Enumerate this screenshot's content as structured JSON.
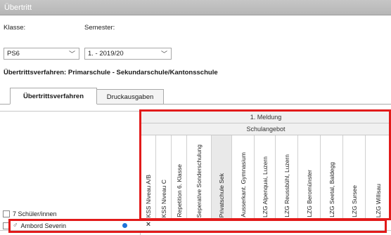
{
  "window": {
    "title": "Übertritt"
  },
  "filters": {
    "klasse_label": "Klasse:",
    "klasse_value": "PS6",
    "semester_label": "Semester:",
    "semester_value": "1. - 2019/20"
  },
  "procedure_title": "Übertrittsverfahren: Primarschule - Sekundarschule/Kantonsschule",
  "tabs": [
    {
      "label": "Übertrittsverfahren",
      "active": true
    },
    {
      "label": "Druckausgaben",
      "active": false
    }
  ],
  "grid": {
    "header_group": "1. Meldung",
    "header_subgroup": "Schulangebot",
    "columns": [
      "KSS Niveau A/B",
      "KSS Niveau C",
      "Repetition 6. Klasse",
      "Seperative Sonderschulung",
      "Privatschule Sek",
      "Ausserkant. Gymnasium",
      "LZG Alpenquai, Luzern",
      "LZG Reussbühl, Luzern",
      "LZG Beromünster",
      "LZG Seetal, Baldegg",
      "LZG Sursee",
      "LZG Willisau"
    ],
    "student_count": "7 Schüler/innen",
    "rows": [
      {
        "gender_icon": "male-icon",
        "gender_glyph": "♂",
        "name": "Ambord Severin",
        "status_color": "#1e73d9",
        "marks": [
          "×"
        ]
      }
    ]
  },
  "colors": {
    "highlight": "#e21a1a",
    "status_blue": "#1e73d9",
    "titlebar": "#bdbdbd"
  }
}
